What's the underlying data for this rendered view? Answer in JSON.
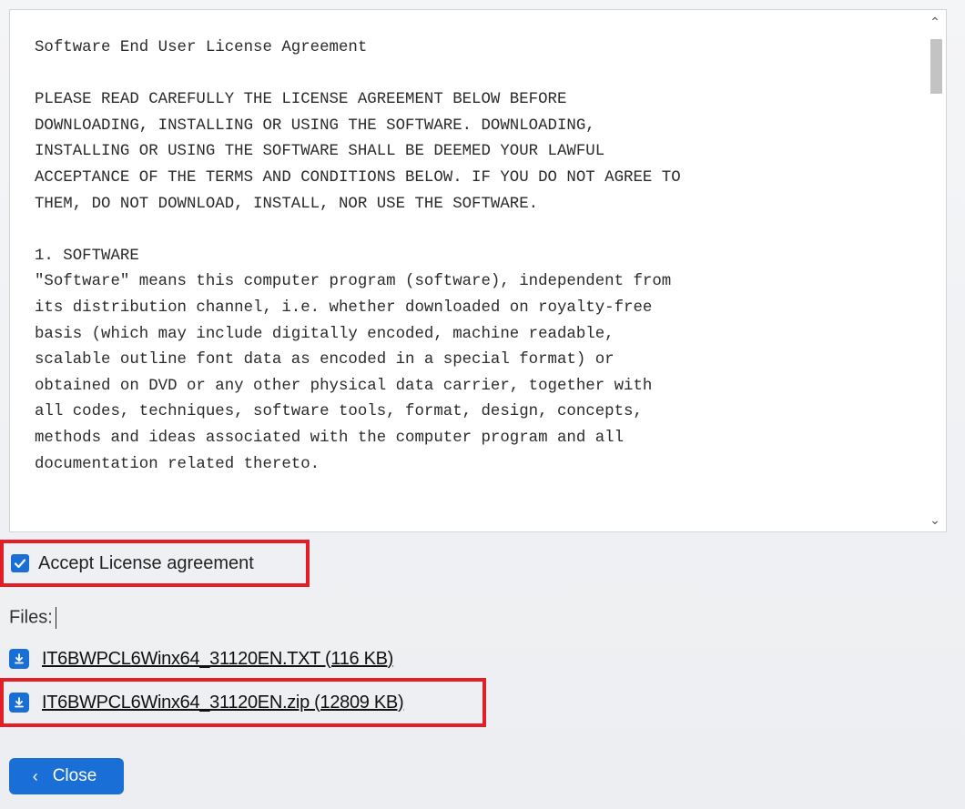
{
  "license": {
    "text": "Software End User License Agreement\n\nPLEASE READ CAREFULLY THE LICENSE AGREEMENT BELOW BEFORE\nDOWNLOADING, INSTALLING OR USING THE SOFTWARE. DOWNLOADING,\nINSTALLING OR USING THE SOFTWARE SHALL BE DEEMED YOUR LAWFUL\nACCEPTANCE OF THE TERMS AND CONDITIONS BELOW. IF YOU DO NOT AGREE TO\nTHEM, DO NOT DOWNLOAD, INSTALL, NOR USE THE SOFTWARE.\n\n1. SOFTWARE\n\"Software\" means this computer program (software), independent from\nits distribution channel, i.e. whether downloaded on royalty-free\nbasis (which may include digitally encoded, machine readable,\nscalable outline font data as encoded in a special format) or\nobtained on DVD or any other physical data carrier, together with\nall codes, techniques, software tools, format, design, concepts,\nmethods and ideas associated with the computer program and all\ndocumentation related thereto.",
    "scroll_up_icon": "chevron-up-icon",
    "scroll_down_icon": "chevron-down-icon"
  },
  "accept": {
    "label": "Accept License agreement",
    "checked": true
  },
  "files": {
    "label": "Files:",
    "items": [
      {
        "name": "IT6BWPCL6Winx64_31120EN.TXT (116 KB)",
        "icon": "download-icon"
      },
      {
        "name": "IT6BWPCL6Winx64_31120EN.zip (12809 KB)",
        "icon": "download-icon"
      }
    ]
  },
  "close_button": {
    "label": "Close",
    "icon": "chevron-left-icon"
  },
  "colors": {
    "accent": "#1a6fd6",
    "highlight": "#e41e26"
  }
}
